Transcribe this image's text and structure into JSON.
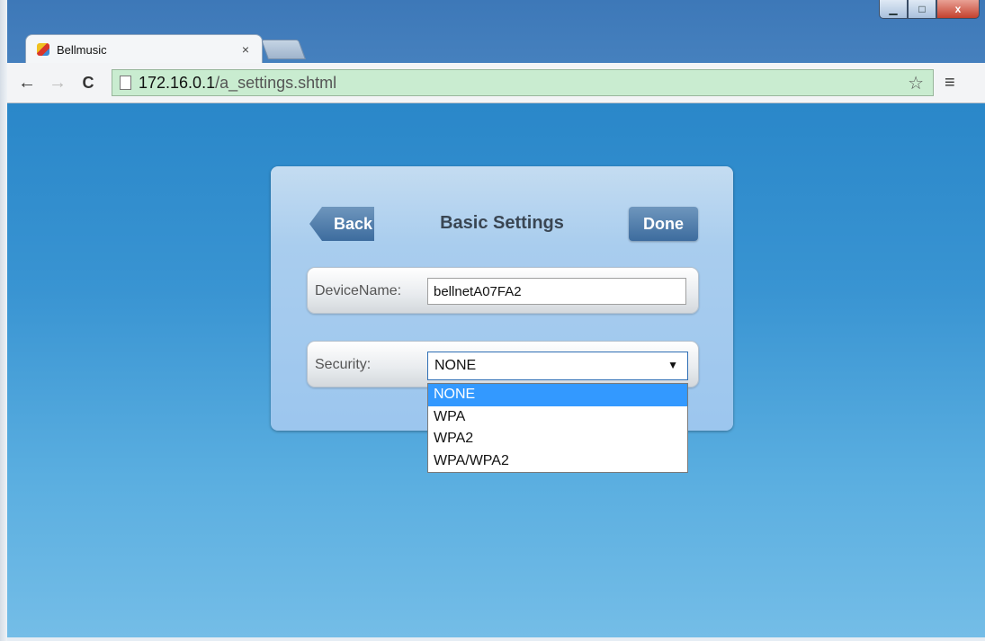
{
  "browser": {
    "tab_title": "Bellmusic",
    "tab_close": "×",
    "url_host": "172.16.0.1",
    "url_path": "/a_settings.shtml",
    "nav": {
      "back": "←",
      "forward": "→",
      "reload": "C"
    },
    "star": "☆",
    "menu": "≡",
    "caption": {
      "minimize": "▁",
      "maximize": "□",
      "close": "x"
    }
  },
  "panel": {
    "title": "Basic Settings",
    "back_label": "Back",
    "done_label": "Done",
    "device_name_label": "DeviceName:",
    "device_name_value": "bellnetA07FA2",
    "security_label": "Security:",
    "security_selected": "NONE",
    "security_arrow": "▼",
    "security_options": [
      "NONE",
      "WPA",
      "WPA2",
      "WPA/WPA2"
    ]
  },
  "colors": {
    "page_bg": "#3994d2",
    "panel_bg": "#a9cdee",
    "button": "#4f7eae",
    "selection": "#3399ff",
    "omnibox": "#c9ecd0"
  }
}
